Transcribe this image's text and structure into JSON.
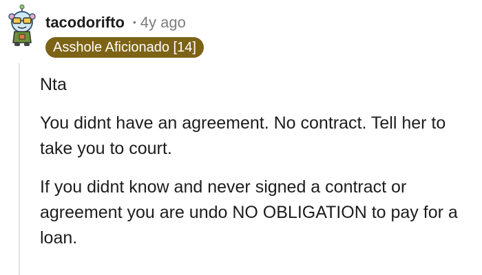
{
  "comment": {
    "username": "tacodorifto",
    "separator": "•",
    "timestamp": "4y ago",
    "flair": "Asshole Aficionado [14]",
    "flair_color": "#7d6316",
    "avatar_icon": "snoo-avatar-icon",
    "paragraphs": [
      "Nta",
      "You didnt have an agreement. No contract. Tell her to take you to court.",
      "If you didnt know and never signed a contract or agreement you are undo NO OBLIGATION to pay for a loan."
    ]
  }
}
